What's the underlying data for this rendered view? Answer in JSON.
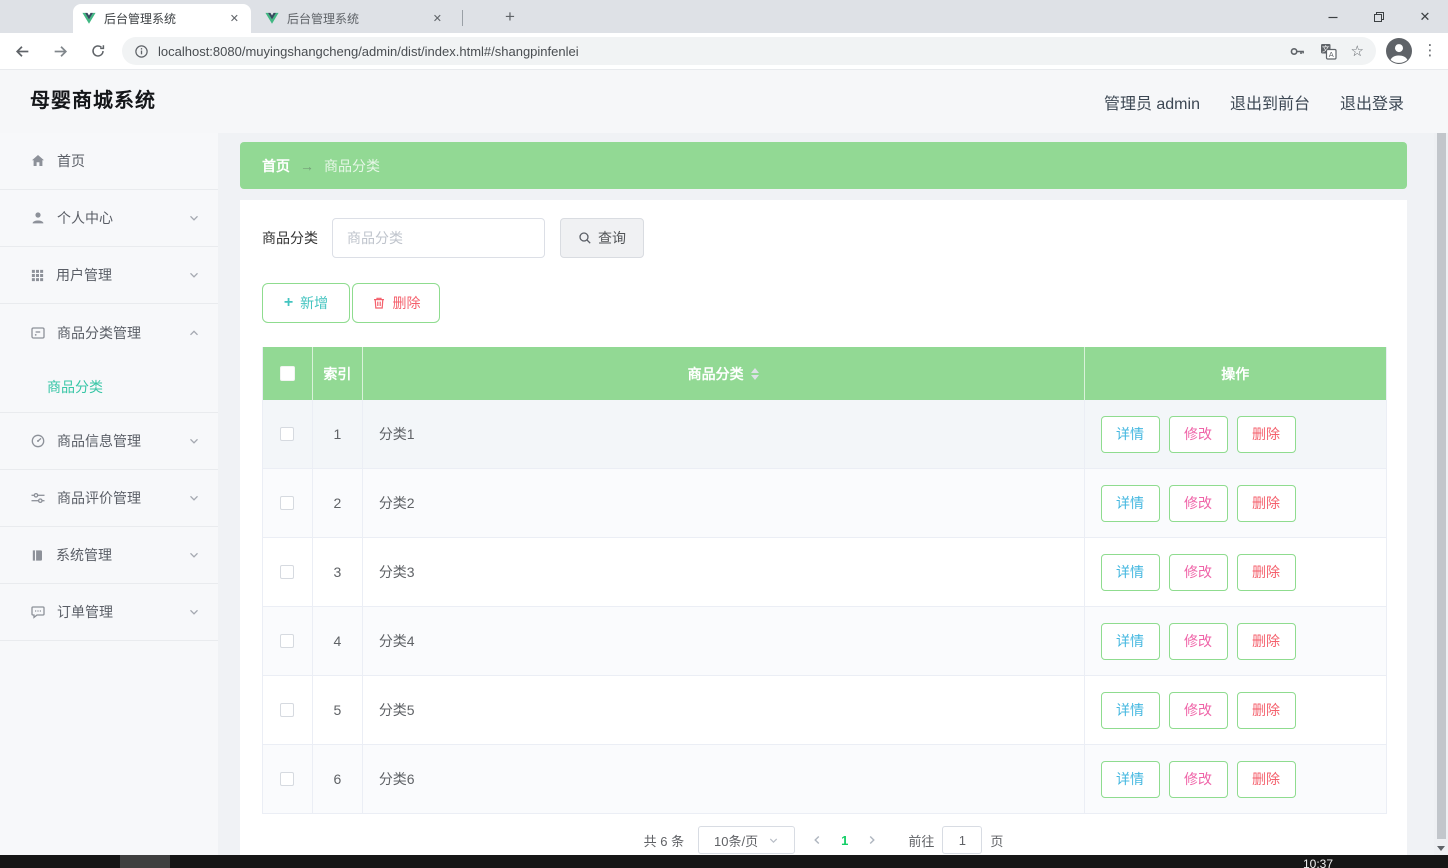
{
  "browser": {
    "tab1_title": "后台管理系统",
    "tab2_title": "后台管理系统",
    "url": "localhost:8080/muyingshangcheng/admin/dist/index.html#/shangpinfenlei"
  },
  "glyphs": {
    "close": "✕",
    "plus": "+",
    "dots": "⋮",
    "star": "☆"
  },
  "header": {
    "logo": "母婴商城系统",
    "user": "管理员 admin",
    "to_front": "退出到前台",
    "logout": "退出登录"
  },
  "sidebar": {
    "items": [
      {
        "label": "首页"
      },
      {
        "label": "个人中心"
      },
      {
        "label": "用户管理"
      },
      {
        "label": "商品分类管理"
      },
      {
        "label": "商品信息管理"
      },
      {
        "label": "商品评价管理"
      },
      {
        "label": "系统管理"
      },
      {
        "label": "订单管理"
      }
    ],
    "submenu": {
      "label": "商品分类"
    }
  },
  "breadcrumb": {
    "home": "首页",
    "arrow": "→",
    "current": "商品分类"
  },
  "filter": {
    "label": "商品分类",
    "placeholder": "商品分类",
    "search_button": "查询"
  },
  "toolbar": {
    "add_button": "新增",
    "delete_button": "删除"
  },
  "table": {
    "col_index": "索引",
    "col_category": "商品分类",
    "col_actions": "操作",
    "rows": [
      {
        "index": "1",
        "category": "分类1"
      },
      {
        "index": "2",
        "category": "分类2"
      },
      {
        "index": "3",
        "category": "分类3"
      },
      {
        "index": "4",
        "category": "分类4"
      },
      {
        "index": "5",
        "category": "分类5"
      },
      {
        "index": "6",
        "category": "分类6"
      }
    ],
    "actions": {
      "detail": "详情",
      "edit": "修改",
      "delete": "删除"
    }
  },
  "pagination": {
    "total": "共 6 条",
    "page_size": "10条/页",
    "page": "1",
    "goto_label": "前往",
    "goto_value": "1",
    "unit": "页"
  },
  "taskbar": {
    "time": "10:37"
  },
  "colors": {
    "theme_green": "#92d994",
    "accent_teal": "#44c4c0",
    "detail_blue": "#45b8e0",
    "edit_pink": "#ef64a8",
    "danger_red": "#f4606c",
    "active_page_green": "#13ce66",
    "submenu_active": "#38c6a6"
  }
}
